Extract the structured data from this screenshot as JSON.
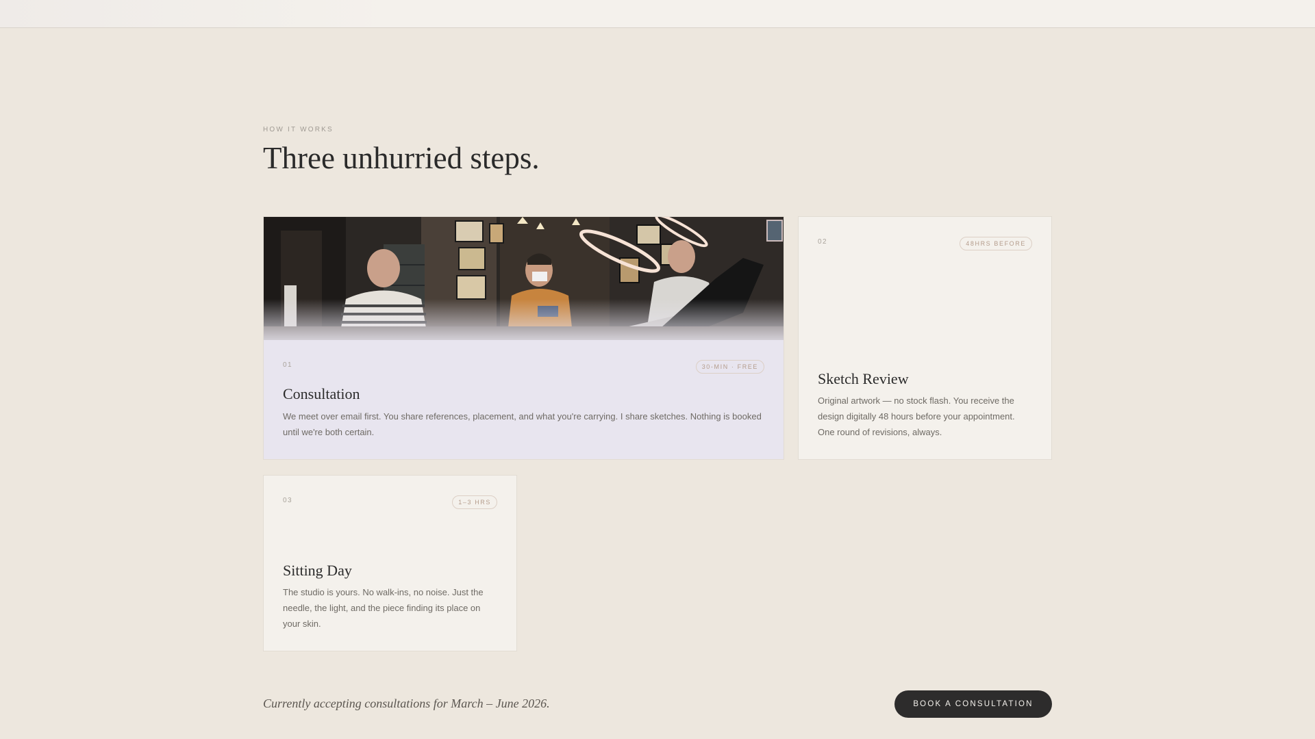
{
  "section": {
    "eyebrow": "HOW IT WORKS",
    "title": "Three unhurried steps."
  },
  "steps": [
    {
      "number": "01",
      "badge": "30-MIN · FREE",
      "title": "Consultation",
      "description": "We meet over email first. You share references, placement, and what you're carrying. I share sketches. Nothing is booked until we're both certain.",
      "image": "tattoo-studio-photo"
    },
    {
      "number": "02",
      "badge": "48HRS BEFORE",
      "title": "Sketch Review",
      "description": "Original artwork — no stock flash. You receive the design digitally 48 hours before your appointment. One round of revisions, always."
    },
    {
      "number": "03",
      "badge": "1–3 HRS",
      "title": "Sitting Day",
      "description": "The studio is yours. No walk-ins, no noise. Just the needle, the light, and the piece finding its place on your skin."
    }
  ],
  "footer": {
    "note": "Currently accepting consultations for March – June 2026.",
    "cta_label": "BOOK A CONSULTATION"
  },
  "colors": {
    "background": "#ede7de",
    "card": "#f4f1ec",
    "featured_card": "#e8e5ef",
    "accent_pill": "#b49c8c",
    "cta": "#2d2c2c"
  }
}
